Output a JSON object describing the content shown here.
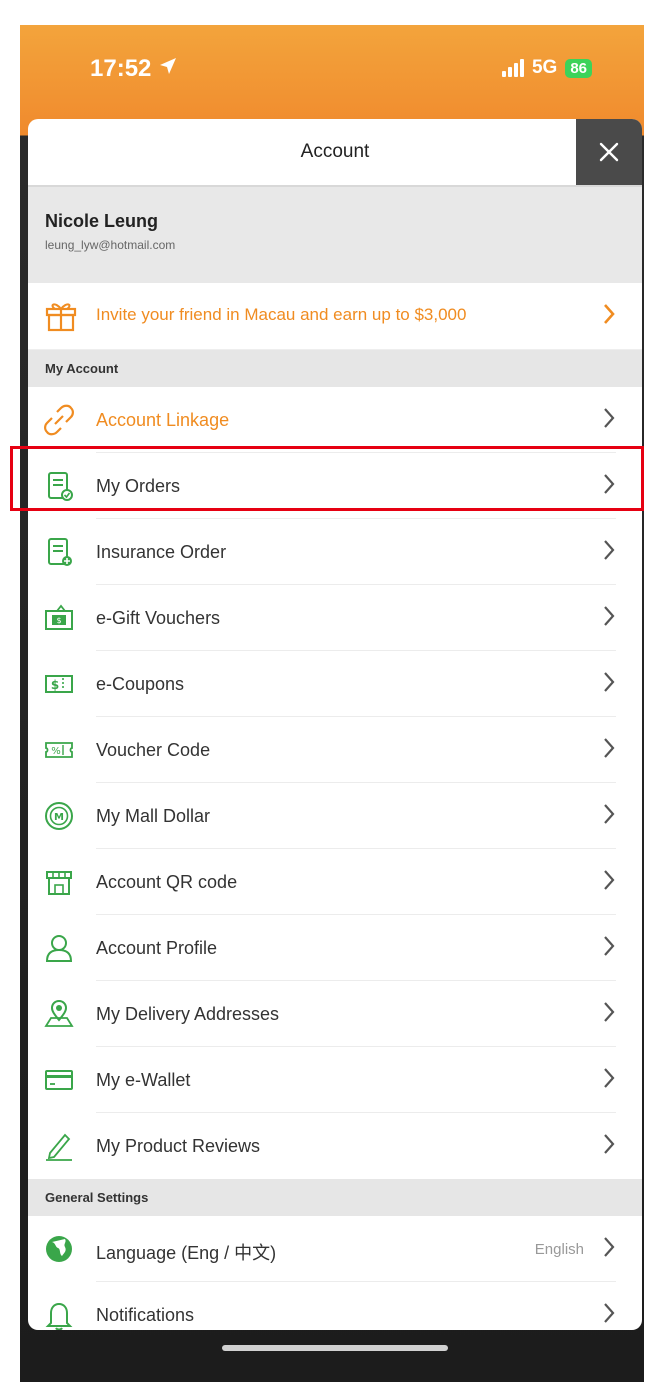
{
  "status_bar": {
    "time": "17:52",
    "network": "5G",
    "battery": "86"
  },
  "header": {
    "title": "Account"
  },
  "user": {
    "name": "Nicole Leung",
    "email": "leung_lyw@hotmail.com"
  },
  "invite": {
    "text": "Invite your friend in Macau and earn up to $3,000"
  },
  "sections": {
    "my_account": "My Account",
    "general_settings": "General Settings"
  },
  "menu": {
    "account_linkage": "Account Linkage",
    "my_orders": "My Orders",
    "insurance_order": "Insurance Order",
    "gift_vouchers": "e-Gift Vouchers",
    "coupons": "e-Coupons",
    "voucher_code": "Voucher Code",
    "mall_dollar": "My Mall Dollar",
    "qr_code": "Account QR code",
    "profile": "Account Profile",
    "delivery": "My Delivery Addresses",
    "wallet": "My e-Wallet",
    "reviews": "My Product Reviews"
  },
  "settings": {
    "language": "Language (Eng / 中文)",
    "language_value": "English",
    "notifications": "Notifications"
  },
  "colors": {
    "accent": "#f08c21",
    "icon_green": "#3aa64a",
    "highlight": "#e60012"
  }
}
